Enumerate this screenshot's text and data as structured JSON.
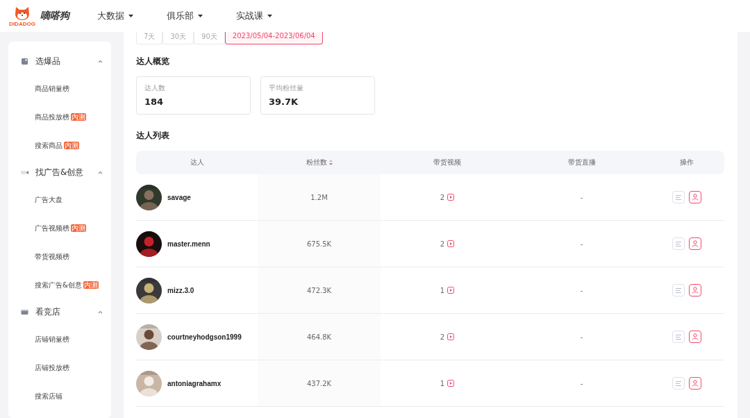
{
  "header": {
    "logo_caption": "DIDADOG",
    "brand": "嘀嗒狗",
    "nav": [
      {
        "label": "大数据"
      },
      {
        "label": "俱乐部"
      },
      {
        "label": "实战课"
      }
    ]
  },
  "sidebar": {
    "groups": [
      {
        "kind": "goods",
        "label": "选爆品",
        "expanded": true,
        "items": [
          {
            "label": "商品销量榜"
          },
          {
            "label": "商品投放榜",
            "badge": "内测"
          },
          {
            "label": "搜索商品",
            "badge": "内测"
          }
        ]
      },
      {
        "kind": "video",
        "label": "找广告&创意",
        "expanded": true,
        "items": [
          {
            "label": "广告大盘"
          },
          {
            "label": "广告视频榜",
            "badge": "内测"
          },
          {
            "label": "带货视频榜"
          },
          {
            "label": "搜索广告&创意",
            "badge": "内测"
          }
        ]
      },
      {
        "kind": "shop",
        "label": "看竞店",
        "expanded": true,
        "items": [
          {
            "label": "店铺销量榜"
          },
          {
            "label": "店铺投放榜"
          },
          {
            "label": "搜索店铺"
          }
        ]
      }
    ]
  },
  "date_tabs": [
    {
      "label": "7天",
      "selected": false
    },
    {
      "label": "30天",
      "selected": false
    },
    {
      "label": "90天",
      "selected": false
    },
    {
      "label": "2023/05/04-2023/06/04",
      "selected": true
    }
  ],
  "overview": {
    "title": "达人概览",
    "stats": [
      {
        "label": "达人数",
        "value": "184"
      },
      {
        "label": "平均粉丝量",
        "value": "39.7K"
      }
    ]
  },
  "list": {
    "title": "达人列表",
    "columns": [
      "达人",
      "粉丝数",
      "带货视频",
      "带货直播",
      "操作"
    ],
    "rows": [
      {
        "name": "savage",
        "fans": "1.2M",
        "videos": "2",
        "live": "-"
      },
      {
        "name": "master.menn",
        "fans": "675.5K",
        "videos": "2",
        "live": "-"
      },
      {
        "name": "mizz.3.0",
        "fans": "472.3K",
        "videos": "1",
        "live": "-"
      },
      {
        "name": "courtneyhodgson1999",
        "fans": "464.8K",
        "videos": "2",
        "live": "-"
      },
      {
        "name": "antoniagrahamx",
        "fans": "437.2K",
        "videos": "1",
        "live": "-"
      }
    ]
  }
}
